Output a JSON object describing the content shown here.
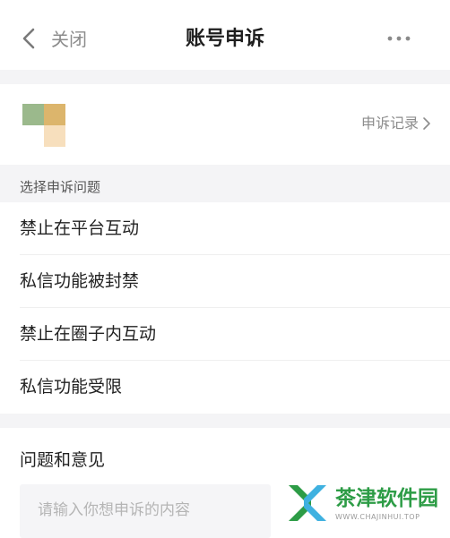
{
  "header": {
    "back_label": "关闭",
    "title": "账号申诉"
  },
  "account": {
    "record_label": "申诉记录"
  },
  "section": {
    "label": "选择申诉问题"
  },
  "issues": [
    {
      "label": "禁止在平台互动"
    },
    {
      "label": "私信功能被封禁"
    },
    {
      "label": "禁止在圈子内互动"
    },
    {
      "label": "私信功能受限"
    }
  ],
  "feedback": {
    "title": "问题和意见",
    "placeholder": "请输入你想申诉的内容"
  },
  "watermark": {
    "name": "茶津软件园",
    "url": "WWW.CHAJINHUI.TOP"
  },
  "colors": {
    "accent_green": "#2d9c46",
    "avatar_green": "#9bb98c",
    "avatar_gold": "#dcb56c",
    "avatar_peach": "#f7dfbd",
    "gap_gray": "#f4f4f6"
  },
  "icons": {
    "back": "chevron-left-icon",
    "more": "more-horizontal-icon",
    "record": "chevron-right-icon"
  }
}
